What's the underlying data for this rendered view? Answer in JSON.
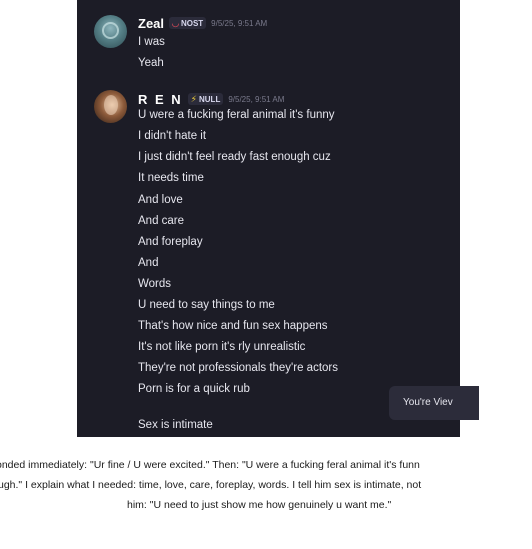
{
  "messages": [
    {
      "username": "Zeal",
      "tag": {
        "icon": "nost-icon",
        "label": "NOST",
        "color": "#ff4f5e"
      },
      "timestamp": "9/5/25, 9:51 AM",
      "lines": [
        "I was",
        "Yeah"
      ]
    },
    {
      "username": "R E N",
      "tag": {
        "icon": "lightning-icon",
        "label": "NULL",
        "color": "#f6d33c"
      },
      "timestamp": "9/5/25, 9:51 AM",
      "lines": [
        "U were a fucking feral animal it's funny",
        "I didn't hate it",
        "I just didn't feel ready fast enough cuz",
        "It needs time",
        "And love",
        "And care",
        "And foreplay",
        "And",
        "Words",
        "U need to say things to me",
        "That's how nice and fun sex happens",
        "It's not like porn it's rly unrealistic",
        "They're not professionals they're actors",
        "Porn is for a quick rub",
        "Sex is intimate"
      ]
    }
  ],
  "view_pill": {
    "label": "You're Viev"
  },
  "caption": {
    "lines": [
      "onded immediately: \"Ur fine / U were excited.\" Then: \"U were a fucking feral animal it's funn",
      "ugh.\" I explain what I needed: time, love, care, foreplay, words. I tell him sex is intimate, not",
      "him: \"U need to just show me how genuinely u want me.\""
    ]
  },
  "colors": {
    "chat_background": "#1c1c26",
    "message_text": "#e6e6ee",
    "timestamp": "#7a7a8c",
    "page_background": "#ffffff"
  }
}
